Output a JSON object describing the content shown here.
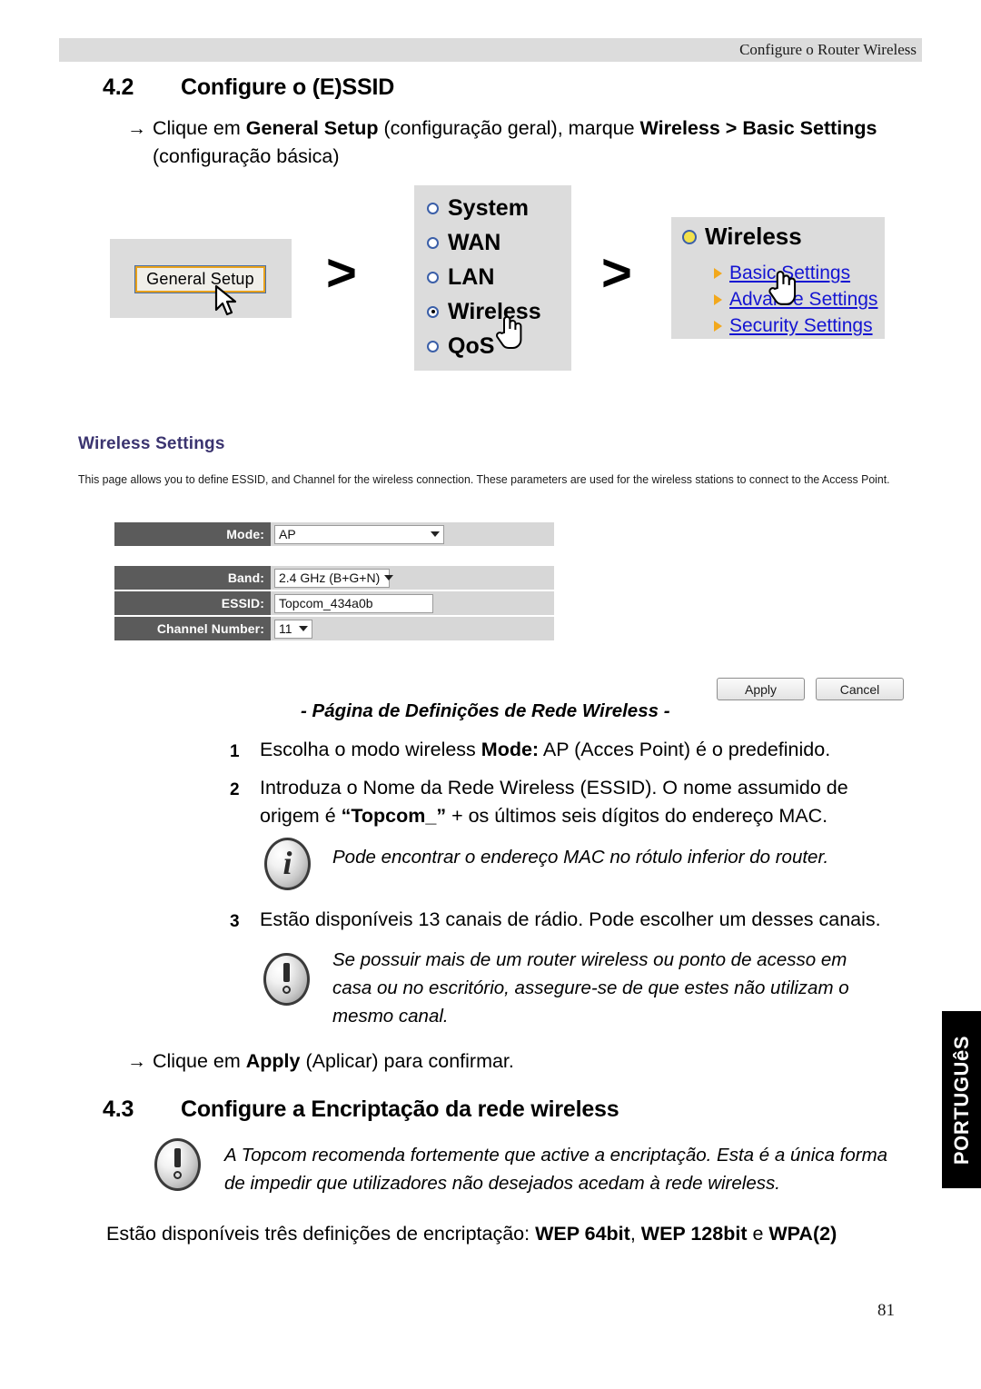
{
  "header": {
    "title": "Configure o Router Wireless"
  },
  "sections": {
    "s42": {
      "number": "4.2",
      "title": "Configure o (E)SSID"
    },
    "s43": {
      "number": "4.3",
      "title": "Configure a Encriptação da rede wireless"
    }
  },
  "intro": {
    "arrow": "→",
    "line1_a": "Clique em ",
    "line1_b": "General Setup",
    "line1_c": " (configuração geral), marque ",
    "line1_d": "Wireless",
    "line1_e": " > ",
    "line1_f": "Basic Settings",
    "line2": "(configuração básica)"
  },
  "screenshots": {
    "general_setup_button": "General Setup",
    "chevron": ">",
    "menu_items": [
      {
        "label": "System",
        "selected": false
      },
      {
        "label": "WAN",
        "selected": false
      },
      {
        "label": "LAN",
        "selected": false
      },
      {
        "label": "Wireless",
        "selected": true
      },
      {
        "label": "QoS",
        "selected": false
      }
    ],
    "tree": {
      "title": "Wireless",
      "items": [
        "Basic Settings",
        "Advance Settings",
        "Security Settings"
      ]
    }
  },
  "wireless_settings": {
    "title": "Wireless Settings",
    "description": "This page allows you to define ESSID, and Channel for the wireless connection. These parameters are used for the wireless stations to connect to the Access Point.",
    "fields": [
      {
        "label": "Mode:",
        "value": "AP",
        "control": "select"
      },
      {
        "label": "Band:",
        "value": "2.4 GHz (B+G+N)",
        "control": "select"
      },
      {
        "label": "ESSID:",
        "value": "Topcom_434a0b",
        "control": "text"
      },
      {
        "label": "Channel Number:",
        "value": "11",
        "control": "select"
      }
    ],
    "apply_label": "Apply",
    "cancel_label": "Cancel"
  },
  "caption": "- Página de Definições de Rede Wireless -",
  "steps": {
    "one": {
      "marker": "1",
      "a": "Escolha o modo wireless ",
      "b": "Mode:",
      "c": " AP (Acces Point) é o predefinido."
    },
    "two": {
      "marker": "2",
      "line1": " Introduza o Nome da Rede Wireless (ESSID). O nome assumido de",
      "line2_a": "origem é ",
      "line2_b": "“Topcom_”",
      "line2_c": " + os últimos seis dígitos do endereço MAC."
    },
    "three": {
      "marker": "3",
      "text": "Estão disponíveis 13 canais de rádio. Pode escolher um desses canais."
    }
  },
  "notes": {
    "info_mac": "Pode encontrar o endereço MAC no rótulo inferior do router.",
    "warn_channel_l1": "Se possuir mais de um router wireless ou ponto de acesso em",
    "warn_channel_l2": "casa ou no escritório, assegure-se de que estes não utilizam o",
    "warn_channel_l3": "mesmo canal.",
    "warn_encrypt_l1": "A Topcom recomenda fortemente que active a encriptação. Esta é a única forma",
    "warn_encrypt_l2": "de impedir que utilizadores não desejados acedam à rede wireless."
  },
  "apply_instruction": {
    "arrow": "→",
    "a": "Clique em ",
    "b": "Apply",
    "c": " (Aplicar) para confirmar."
  },
  "encryption_line": {
    "a": "Estão disponíveis três definições de encriptação: ",
    "b": "WEP 64bit",
    "c": ", ",
    "d": "WEP 128bit",
    "e": " e ",
    "f": "WPA(2)"
  },
  "language_tab": "PORTUGUêS",
  "page_number": "81"
}
